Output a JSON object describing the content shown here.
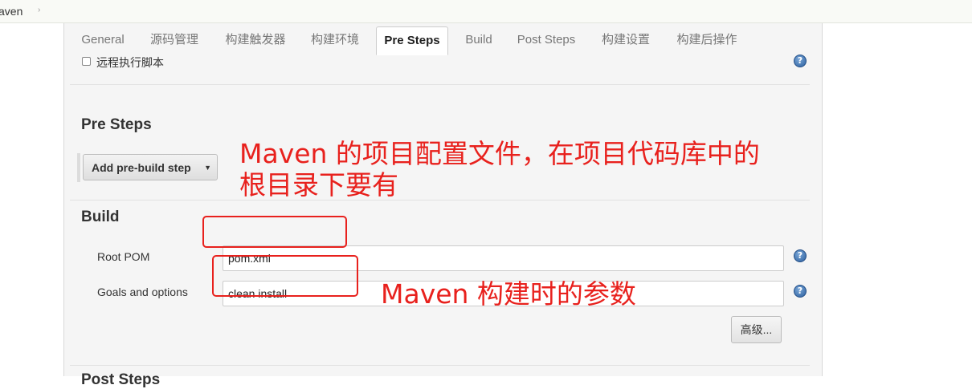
{
  "breadcrumb": {
    "text": "aven",
    "arrow": "›"
  },
  "tabs": [
    {
      "label": "General"
    },
    {
      "label": "源码管理"
    },
    {
      "label": "构建触发器"
    },
    {
      "label": "构建环境"
    },
    {
      "label": "Pre Steps"
    },
    {
      "label": "Build"
    },
    {
      "label": "Post Steps"
    },
    {
      "label": "构建设置"
    },
    {
      "label": "构建后操作"
    }
  ],
  "active_tab": "Pre Steps",
  "remote_script": {
    "label": "远程执行脚本",
    "checked": false
  },
  "help_glyph": "?",
  "pre_steps": {
    "title": "Pre Steps",
    "add_button": "Add pre-build step",
    "caret": "▼"
  },
  "build": {
    "title": "Build",
    "root_pom": {
      "label": "Root POM",
      "value": "pom.xml"
    },
    "goals": {
      "label": "Goals and options",
      "value": "clean install"
    },
    "advanced_button": "高级..."
  },
  "post_steps": {
    "title": "Post Steps"
  },
  "annotations": {
    "note1_line1": "Maven 的项目配置文件，在项目代码库中的",
    "note1_line2": "根目录下要有",
    "note2": "Maven 构建时的参数",
    "color": "#e8211d"
  },
  "colors": {
    "help_blue": "#2c5f9e",
    "panel_bg": "#f5f5f5"
  }
}
